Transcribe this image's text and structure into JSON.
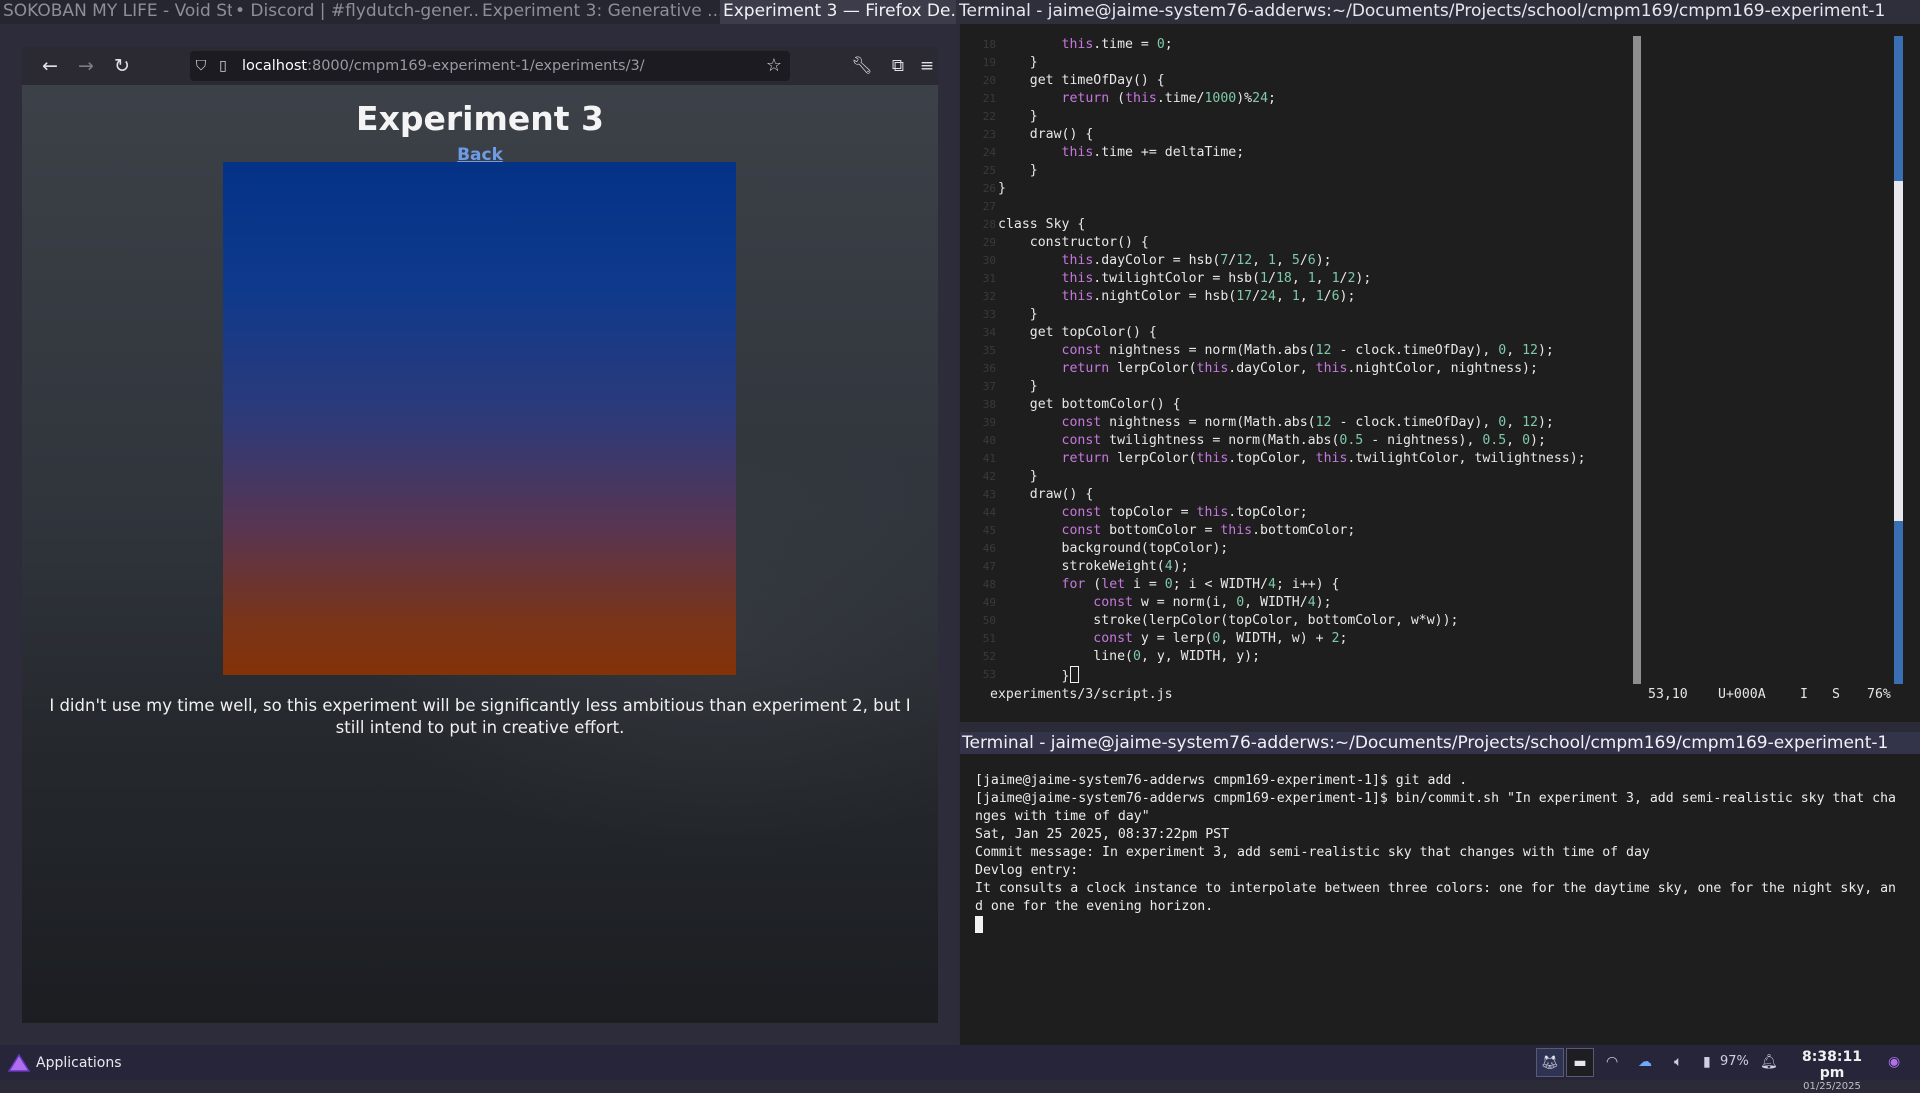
{
  "window_tabs": [
    "SOKOBAN MY LIFE - Void St...",
    "• Discord | #flydutch-gener...",
    "Experiment 3: Generative ...",
    "Experiment 3 — Firefox De...",
    "Terminal - jaime@jaime-system76-adderws:~/Documents/Projects/school/cmpm169/cmpm169-experiment-1"
  ],
  "browser": {
    "url_host": "localhost",
    "url_path": ":8000/cmpm169-experiment-1/experiments/3/",
    "page_title": "Experiment 3",
    "back_link": "Back",
    "paragraph": "I didn't use my time well, so this experiment will be significantly less ambitious than experiment 2, but I still intend to put in creative effort.",
    "sky_colors": {
      "top": "#043287",
      "bottom": "#843208"
    }
  },
  "editor": {
    "lines": [
      {
        "n": "18",
        "text": "        this.time = 0;"
      },
      {
        "n": "19",
        "text": "    }"
      },
      {
        "n": "20",
        "text": "    get timeOfDay() {"
      },
      {
        "n": "21",
        "text": "        return (this.time/1000)%24;"
      },
      {
        "n": "22",
        "text": "    }"
      },
      {
        "n": "23",
        "text": "    draw() {"
      },
      {
        "n": "24",
        "text": "        this.time += deltaTime;"
      },
      {
        "n": "25",
        "text": "    }"
      },
      {
        "n": "26",
        "text": "}"
      },
      {
        "n": "27",
        "text": ""
      },
      {
        "n": "28",
        "text": "class Sky {"
      },
      {
        "n": "29",
        "text": "    constructor() {"
      },
      {
        "n": "30",
        "text": "        this.dayColor = hsb(7/12, 1, 5/6);"
      },
      {
        "n": "31",
        "text": "        this.twilightColor = hsb(1/18, 1, 1/2);"
      },
      {
        "n": "32",
        "text": "        this.nightColor = hsb(17/24, 1, 1/6);"
      },
      {
        "n": "33",
        "text": "    }"
      },
      {
        "n": "34",
        "text": "    get topColor() {"
      },
      {
        "n": "35",
        "text": "        const nightness = norm(Math.abs(12 - clock.timeOfDay), 0, 12);"
      },
      {
        "n": "36",
        "text": "        return lerpColor(this.dayColor, this.nightColor, nightness);"
      },
      {
        "n": "37",
        "text": "    }"
      },
      {
        "n": "38",
        "text": "    get bottomColor() {"
      },
      {
        "n": "39",
        "text": "        const nightness = norm(Math.abs(12 - clock.timeOfDay), 0, 12);"
      },
      {
        "n": "40",
        "text": "        const twilightness = norm(Math.abs(0.5 - nightness), 0.5, 0);"
      },
      {
        "n": "41",
        "text": "        return lerpColor(this.topColor, this.twilightColor, twilightness);"
      },
      {
        "n": "42",
        "text": "    }"
      },
      {
        "n": "43",
        "text": "    draw() {"
      },
      {
        "n": "44",
        "text": "        const topColor = this.topColor;"
      },
      {
        "n": "45",
        "text": "        const bottomColor = this.bottomColor;"
      },
      {
        "n": "46",
        "text": "        background(topColor);"
      },
      {
        "n": "47",
        "text": "        strokeWeight(4);"
      },
      {
        "n": "48",
        "text": "        for (let i = 0; i < WIDTH/4; i++) {"
      },
      {
        "n": "49",
        "text": "            const w = norm(i, 0, WIDTH/4);"
      },
      {
        "n": "50",
        "text": "            stroke(lerpColor(topColor, bottomColor, w*w));"
      },
      {
        "n": "51",
        "text": "            const y = lerp(0, WIDTH, w) + 2;"
      },
      {
        "n": "52",
        "text": "            line(0, y, WIDTH, y);"
      },
      {
        "n": "53",
        "text": "        }"
      }
    ],
    "status": {
      "filename": "experiments/3/script.js",
      "position": "53,10",
      "char": "U+000A",
      "mode1": "I",
      "mode2": "S",
      "percent": "76%"
    }
  },
  "terminal": {
    "title": "Terminal - jaime@jaime-system76-adderws:~/Documents/Projects/school/cmpm169/cmpm169-experiment-1",
    "lines": [
      "[jaime@jaime-system76-adderws cmpm169-experiment-1]$ git add .",
      "[jaime@jaime-system76-adderws cmpm169-experiment-1]$ bin/commit.sh \"In experiment 3, add semi-realistic sky that cha",
      "nges with time of day\"",
      "Sat, Jan 25 2025, 08:37:22pm PST",
      "Commit message: In experiment 3, add semi-realistic sky that changes with time of day",
      "Devlog entry:",
      "It consults a clock instance to interpolate between three colors: one for the daytime sky, one for the night sky, an",
      "d one for the evening horizon."
    ]
  },
  "taskbar": {
    "applications_label": "Applications",
    "battery": "97%",
    "time": "8:38:11 pm",
    "date": "01/25/2025"
  }
}
